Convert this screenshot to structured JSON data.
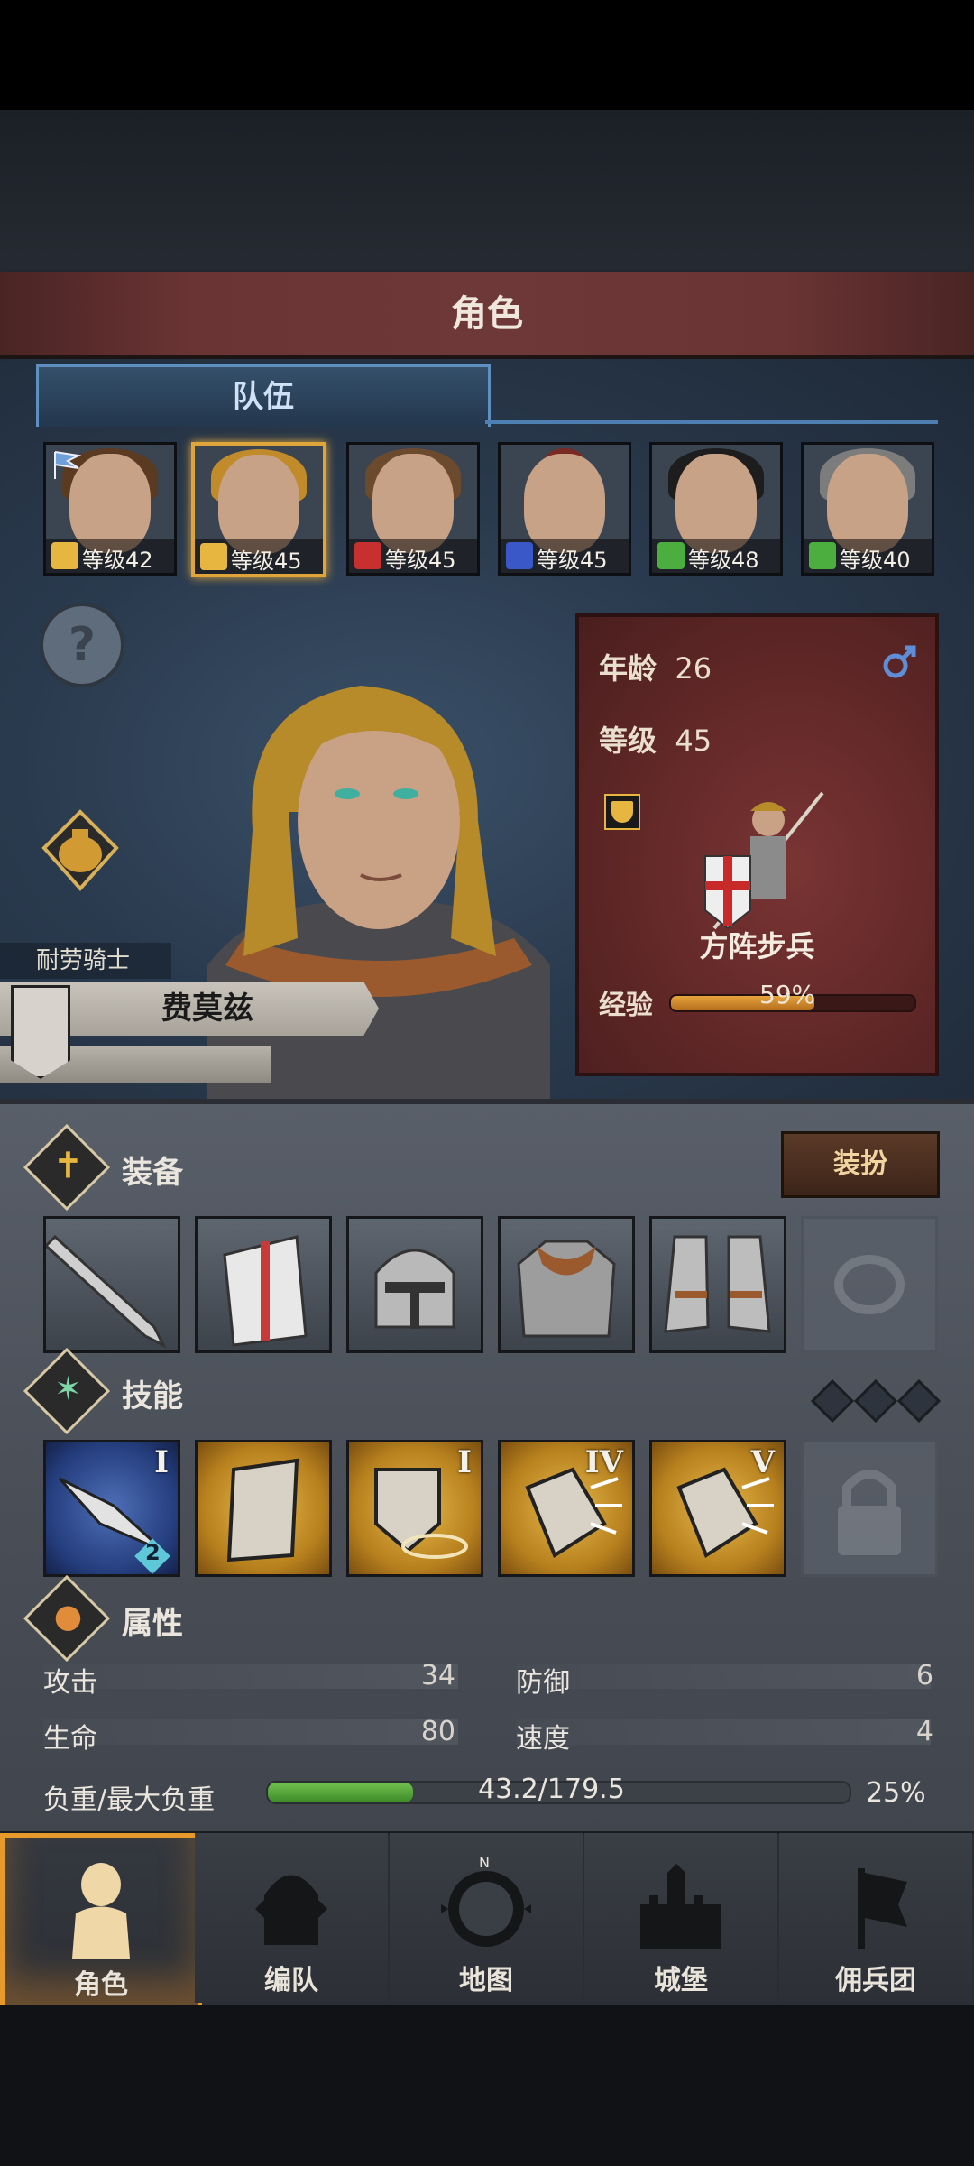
{
  "header": {
    "title": "角色"
  },
  "tabs": [
    {
      "label": "队伍",
      "active": true
    }
  ],
  "party": [
    {
      "level_text": "等级42",
      "class_icon": "shield-icon",
      "flag": true,
      "selected": false
    },
    {
      "level_text": "等级45",
      "class_icon": "shield-icon",
      "selected": true
    },
    {
      "level_text": "等级45",
      "class_icon": "horse-icon",
      "selected": false
    },
    {
      "level_text": "等级45",
      "class_icon": "sword-icon",
      "selected": false
    },
    {
      "level_text": "等级48",
      "class_icon": "crossed-box-icon",
      "selected": false
    },
    {
      "level_text": "等级40",
      "class_icon": "crossed-box-icon",
      "selected": false
    }
  ],
  "character": {
    "trait": "耐劳骑士",
    "name": "费莫兹",
    "age_label": "年龄",
    "age": "26",
    "gender_icon": "male-icon",
    "level_label": "等级",
    "level": "45",
    "unit_class": "方阵步兵",
    "exp_label": "经验",
    "exp_text": "59%",
    "exp_fraction": 0.59
  },
  "equipment": {
    "title": "装备",
    "dress_button": "装扮",
    "slots": [
      "sword-icon",
      "shield-icon",
      "helmet-icon",
      "chainmail-icon",
      "boots-icon",
      "ring-icon"
    ]
  },
  "skills": {
    "title": "技能",
    "items": [
      {
        "icon": "charge-icon",
        "tier": "I",
        "badge": "2",
        "color": "blue"
      },
      {
        "icon": "tower-shield-icon",
        "tier": "",
        "color": "gold"
      },
      {
        "icon": "shield-guard-icon",
        "tier": "I",
        "color": "gold"
      },
      {
        "icon": "shield-bash-icon",
        "tier": "IV",
        "color": "gold"
      },
      {
        "icon": "shield-bash-icon",
        "tier": "V",
        "color": "gold"
      },
      {
        "icon": "lock-icon",
        "tier": "",
        "color": "locked"
      }
    ]
  },
  "attributes": {
    "title": "属性",
    "attack_label": "攻击",
    "attack": "34",
    "defense_label": "防御",
    "defense": "6",
    "hp_label": "生命",
    "hp": "80",
    "speed_label": "速度",
    "speed": "4",
    "load_label": "负重/最大负重",
    "load_text": "43.2/179.5",
    "load_percent": "25%",
    "load_fraction": 0.25
  },
  "nav": [
    {
      "label": "角色",
      "icon": "knight-icon",
      "active": true
    },
    {
      "label": "编队",
      "icon": "helmet-icon"
    },
    {
      "label": "地图",
      "icon": "compass-icon"
    },
    {
      "label": "城堡",
      "icon": "castle-icon"
    },
    {
      "label": "佣兵团",
      "icon": "banner-icon"
    }
  ],
  "colors": {
    "accent": "#e79a2c",
    "title_bar": "#6b3434",
    "panel_blue": "#2a3a4e",
    "card_red": "#5e2626"
  }
}
